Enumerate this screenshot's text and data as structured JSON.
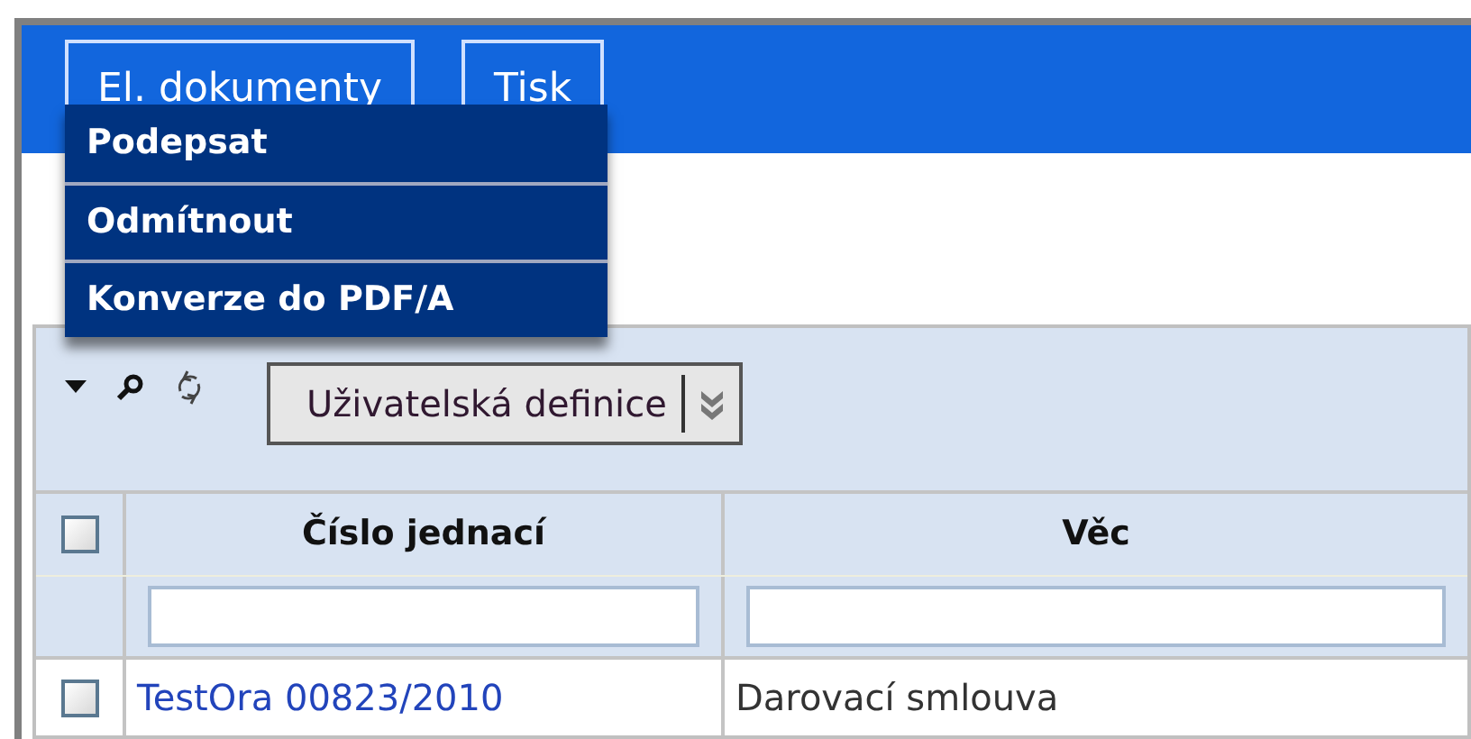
{
  "toolbar": {
    "buttons": [
      "El. dokumenty",
      "Tisk"
    ]
  },
  "menu": {
    "items": [
      "Podepsat",
      "Odmítnout",
      "Konverze do PDF/A"
    ]
  },
  "grid": {
    "definition_button": "Uživatelská definice",
    "header_checkbox": {
      "checked": false
    },
    "columns": [
      "Číslo jednací",
      "Věc"
    ],
    "rows": [
      {
        "checked": false,
        "cells": [
          "TestOra 00823/2010",
          "Darovací smlouva"
        ]
      }
    ]
  }
}
